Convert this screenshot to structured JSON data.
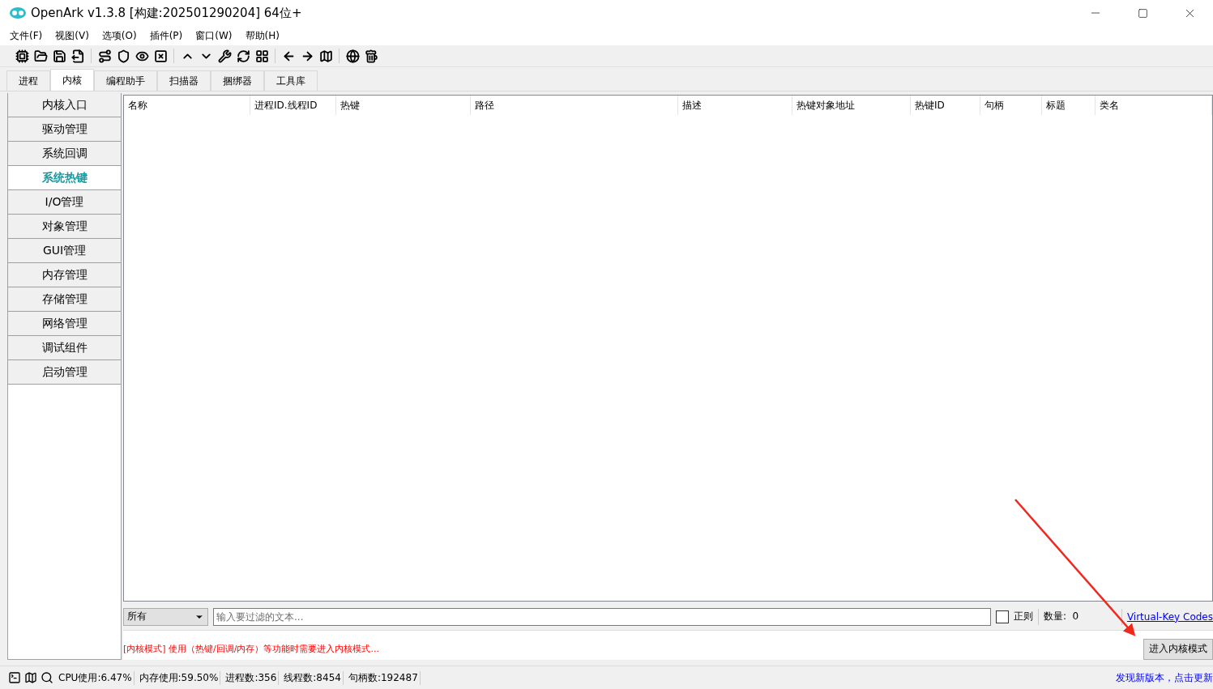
{
  "window": {
    "title": "OpenArk v1.3.8 [构建:202501290204]  64位+"
  },
  "menu": [
    "文件(F)",
    "视图(V)",
    "选项(O)",
    "插件(P)",
    "窗口(W)",
    "帮助(H)"
  ],
  "tabs": [
    {
      "label": "进程",
      "selected": false
    },
    {
      "label": "内核",
      "selected": true
    },
    {
      "label": "编程助手",
      "selected": false
    },
    {
      "label": "扫描器",
      "selected": false
    },
    {
      "label": "捆绑器",
      "selected": false
    },
    {
      "label": "工具库",
      "selected": false
    }
  ],
  "sidebar": {
    "items": [
      {
        "label": "内核入口",
        "selected": false
      },
      {
        "label": "驱动管理",
        "selected": false
      },
      {
        "label": "系统回调",
        "selected": false
      },
      {
        "label": "系统热键",
        "selected": true
      },
      {
        "label": "I/O管理",
        "selected": false
      },
      {
        "label": "对象管理",
        "selected": false
      },
      {
        "label": "GUI管理",
        "selected": false
      },
      {
        "label": "内存管理",
        "selected": false
      },
      {
        "label": "存储管理",
        "selected": false
      },
      {
        "label": "网络管理",
        "selected": false
      },
      {
        "label": "调试组件",
        "selected": false
      },
      {
        "label": "启动管理",
        "selected": false
      }
    ]
  },
  "table": {
    "columns": [
      "名称",
      "进程ID.线程ID",
      "热键",
      "路径",
      "描述",
      "热键对象地址",
      "热键ID",
      "句柄",
      "标题",
      "类名"
    ]
  },
  "filter": {
    "scope": "所有",
    "placeholder": "输入要过滤的文本...",
    "regex": {
      "label": "正则",
      "checked": false
    },
    "count": "数量:  0",
    "link": "Virtual-Key Codes"
  },
  "notice": "[内核模式] 使用（热键/回调/内存）等功能时需要进入内核模式...",
  "enter_button": "进入内核模式",
  "status_bar": {
    "items": [
      "CPU使用:6.47%",
      "内存使用:59.50%",
      "进程数:356",
      "线程数:8454",
      "句柄数:192487"
    ],
    "update_link": "发现新版本，点击更新"
  }
}
